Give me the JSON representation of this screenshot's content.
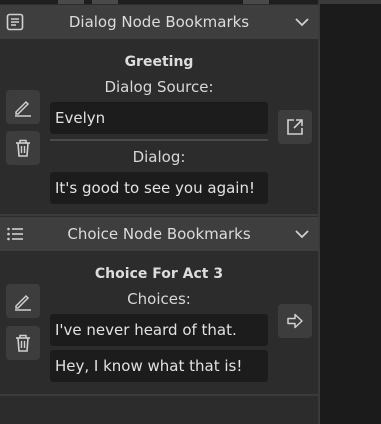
{
  "dialog_section": {
    "header_title": "Dialog Node Bookmarks",
    "header_icon": "document-lines-icon",
    "collapse_icon": "chevron-down-icon",
    "node_title": "Greeting",
    "source_label": "Dialog Source:",
    "source_value": "Evelyn",
    "dialog_label": "Dialog:",
    "dialog_value": "It's good to see you again!",
    "edit_icon": "pencil-icon",
    "delete_icon": "trash-icon",
    "open_icon": "external-link-icon"
  },
  "choice_section": {
    "header_title": "Choice Node Bookmarks",
    "header_icon": "list-icon",
    "collapse_icon": "chevron-down-icon",
    "node_title": "Choice For Act 3",
    "choices_label": "Choices:",
    "choices": [
      "I've never heard of that.",
      "Hey, I know what that is!"
    ],
    "edit_icon": "pencil-icon",
    "delete_icon": "trash-icon",
    "go_icon": "arrow-right-icon"
  },
  "colors": {
    "panel_bg": "#2c2c2c",
    "header_bg": "#3e3e3e",
    "field_bg": "#1c1c1c",
    "button_bg": "#3d3d3d",
    "text": "#d8d8d8"
  }
}
